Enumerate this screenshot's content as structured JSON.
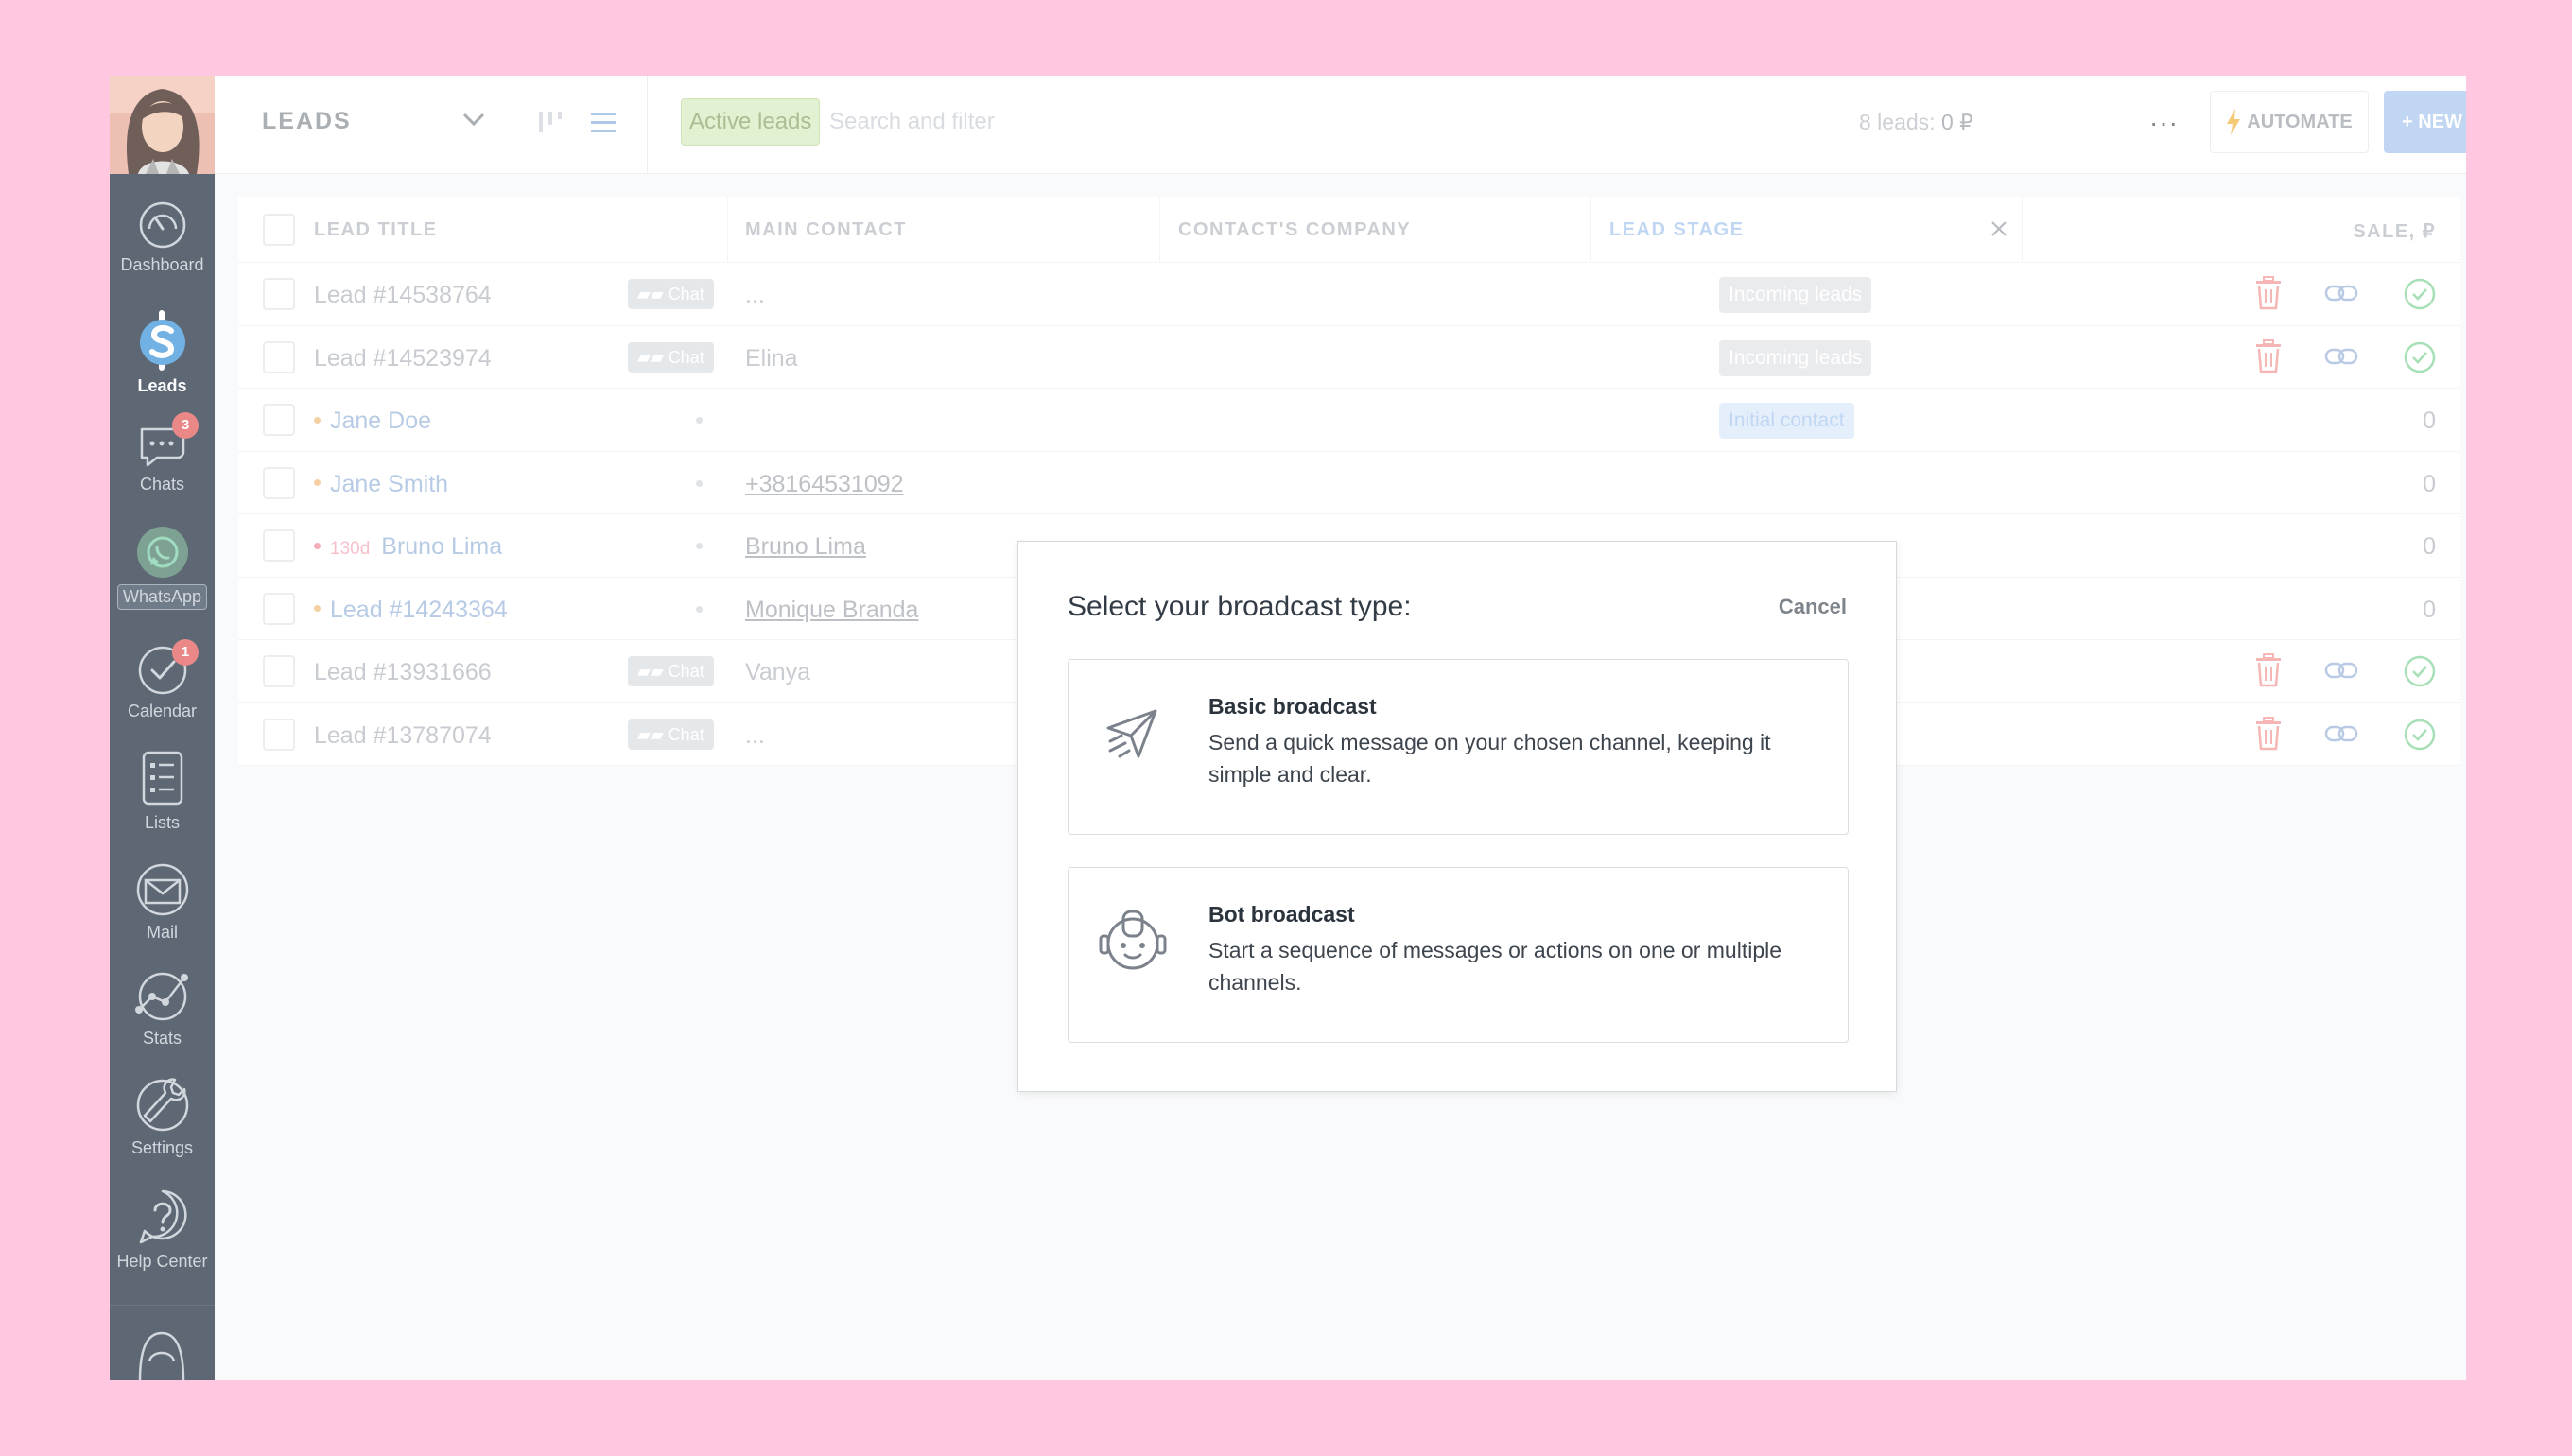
{
  "sidebar": {
    "items": [
      {
        "id": "dashboard",
        "label": "Dashboard",
        "icon": "speedometer-icon"
      },
      {
        "id": "leads",
        "label": "Leads",
        "icon": "dollar-icon"
      },
      {
        "id": "chats",
        "label": "Chats",
        "icon": "chat-bubble-icon",
        "badge": "3"
      },
      {
        "id": "whatsapp",
        "label": "WhatsApp",
        "icon": "whatsapp-icon"
      },
      {
        "id": "calendar",
        "label": "Calendar",
        "icon": "check-circle-icon",
        "badge": "1"
      },
      {
        "id": "lists",
        "label": "Lists",
        "icon": "list-icon"
      },
      {
        "id": "mail",
        "label": "Mail",
        "icon": "envelope-icon"
      },
      {
        "id": "stats",
        "label": "Stats",
        "icon": "chart-line-icon"
      },
      {
        "id": "settings",
        "label": "Settings",
        "icon": "wrench-icon"
      },
      {
        "id": "help",
        "label": "Help Center",
        "icon": "question-icon"
      }
    ]
  },
  "topbar": {
    "title": "LEADS",
    "filter_chip": "Active leads",
    "search_placeholder": "Search and filter",
    "count_label": "8 leads:",
    "count_amount": "0 ₽",
    "more": "···",
    "automate": "AUTOMATE",
    "new_lead": "+ NEW LEAD"
  },
  "table": {
    "columns": [
      "LEAD TITLE",
      "MAIN CONTACT",
      "CONTACT'S COMPANY",
      "LEAD STAGE",
      "SALE, ₽"
    ],
    "chat_label": "Chat",
    "rows": [
      {
        "title": "Lead #14538764",
        "contact": "...",
        "stage": "Incoming leads",
        "sale": ""
      },
      {
        "title": "Lead #14523974",
        "contact": "Elina",
        "stage": "Incoming leads",
        "sale": ""
      },
      {
        "title": "Jane Doe",
        "contact": "",
        "stage": "Initial contact",
        "sale": "0"
      },
      {
        "title": "Jane Smith",
        "contact": "+38164531092",
        "stage": "",
        "sale": "0"
      },
      {
        "title": "Bruno Lima",
        "overdue": "130d",
        "contact": "Bruno Lima",
        "stage": "",
        "sale": "0"
      },
      {
        "title": "Lead #14243364",
        "contact": "Monique Branda",
        "stage": "",
        "sale": "0"
      },
      {
        "title": "Lead #13931666",
        "contact": "Vanya",
        "stage": "",
        "sale": ""
      },
      {
        "title": "Lead #13787074",
        "contact": "...",
        "stage": "",
        "sale": ""
      }
    ]
  },
  "modal": {
    "title": "Select your broadcast type:",
    "cancel": "Cancel",
    "options": [
      {
        "title": "Basic broadcast",
        "description": "Send a quick message on your chosen channel, keeping it simple and clear.",
        "icon": "paper-plane-icon"
      },
      {
        "title": "Bot broadcast",
        "description": "Start a sequence of messages or actions on one or multiple channels.",
        "icon": "robot-icon"
      }
    ]
  },
  "colors": {
    "sidebar": "#1f2e3f",
    "page_background": "#ffc8e0",
    "accent_blue": "#a8c7ef",
    "badge_red": "#e25a5a",
    "active_chip_green": "#d7ecbf"
  }
}
